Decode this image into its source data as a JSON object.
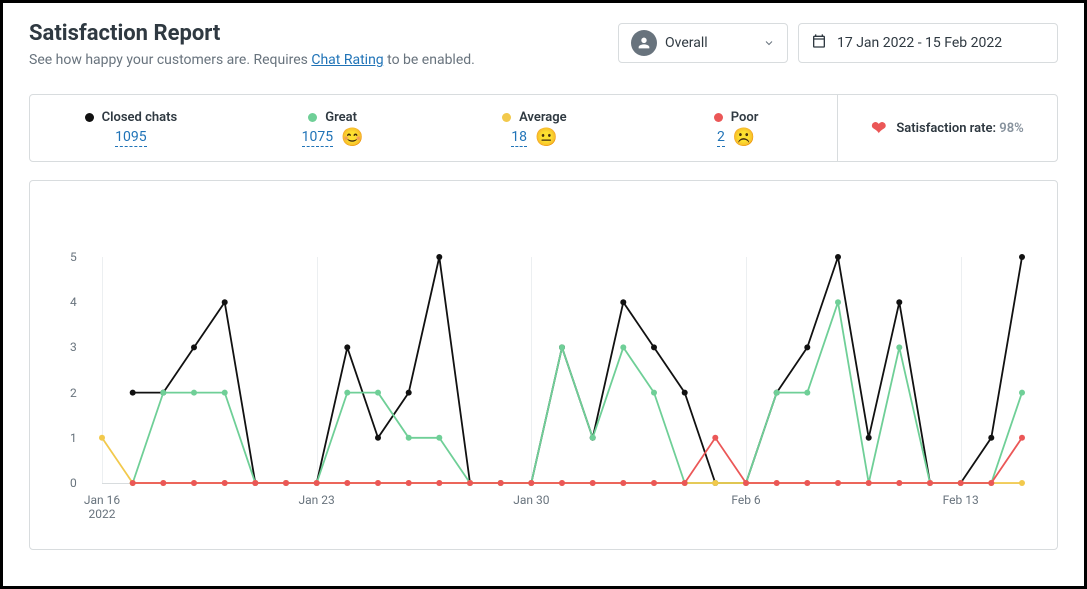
{
  "header": {
    "title": "Satisfaction Report",
    "subtitle_prefix": "See how happy your customers are. Requires ",
    "subtitle_link": "Chat Rating",
    "subtitle_suffix": " to be enabled."
  },
  "controls": {
    "scope_label": "Overall",
    "date_range": "17 Jan 2022 - 15 Feb 2022"
  },
  "stats": {
    "closed": {
      "label": "Closed chats",
      "value": "1095",
      "color": "#111111"
    },
    "great": {
      "label": "Great",
      "value": "1075",
      "color": "#6fcf97",
      "emoji": "😊"
    },
    "average": {
      "label": "Average",
      "value": "18",
      "color": "#f2c94c",
      "emoji": "😐"
    },
    "poor": {
      "label": "Poor",
      "value": "2",
      "color": "#eb5757",
      "emoji": "☹️"
    },
    "satisfaction_label": "Satisfaction rate:",
    "satisfaction_value": "98%"
  },
  "chart_data": {
    "type": "line",
    "ylim": [
      0,
      5
    ],
    "yticks": [
      0,
      1,
      2,
      3,
      4,
      5
    ],
    "x_labels": [
      {
        "index": 0,
        "label": "Jan 16\n2022"
      },
      {
        "index": 7,
        "label": "Jan 23"
      },
      {
        "index": 14,
        "label": "Jan 30"
      },
      {
        "index": 21,
        "label": "Feb 6"
      },
      {
        "index": 28,
        "label": "Feb 13"
      }
    ],
    "categories": [
      "Jan 16",
      "Jan 17",
      "Jan 18",
      "Jan 19",
      "Jan 20",
      "Jan 21",
      "Jan 22",
      "Jan 23",
      "Jan 24",
      "Jan 25",
      "Jan 26",
      "Jan 27",
      "Jan 28",
      "Jan 29",
      "Jan 30",
      "Jan 31",
      "Feb 1",
      "Feb 2",
      "Feb 3",
      "Feb 4",
      "Feb 5",
      "Feb 6",
      "Feb 7",
      "Feb 8",
      "Feb 9",
      "Feb 10",
      "Feb 11",
      "Feb 12",
      "Feb 13",
      "Feb 14",
      "Feb 15"
    ],
    "series": [
      {
        "name": "Closed chats",
        "color": "#111111",
        "values": [
          null,
          2,
          2,
          3,
          4,
          0,
          0,
          0,
          3,
          1,
          2,
          5,
          0,
          0,
          0,
          3,
          1,
          4,
          3,
          2,
          0,
          0,
          2,
          3,
          5,
          1,
          4,
          0,
          0,
          1,
          5
        ]
      },
      {
        "name": "Great",
        "color": "#6fcf97",
        "values": [
          null,
          0,
          2,
          2,
          2,
          0,
          0,
          0,
          2,
          2,
          1,
          1,
          0,
          0,
          0,
          3,
          1,
          3,
          2,
          0,
          0,
          0,
          2,
          2,
          4,
          0,
          3,
          0,
          0,
          0,
          2
        ]
      },
      {
        "name": "Average",
        "color": "#f2c94c",
        "values": [
          1,
          0,
          0,
          0,
          0,
          0,
          0,
          0,
          0,
          0,
          0,
          0,
          0,
          0,
          0,
          0,
          0,
          0,
          0,
          0,
          0,
          0,
          0,
          0,
          0,
          0,
          0,
          0,
          0,
          0,
          0
        ]
      },
      {
        "name": "Poor",
        "color": "#eb5757",
        "values": [
          null,
          0,
          0,
          0,
          0,
          0,
          0,
          0,
          0,
          0,
          0,
          0,
          0,
          0,
          0,
          0,
          0,
          0,
          0,
          0,
          1,
          0,
          0,
          0,
          0,
          0,
          0,
          0,
          0,
          0,
          1
        ]
      }
    ]
  }
}
